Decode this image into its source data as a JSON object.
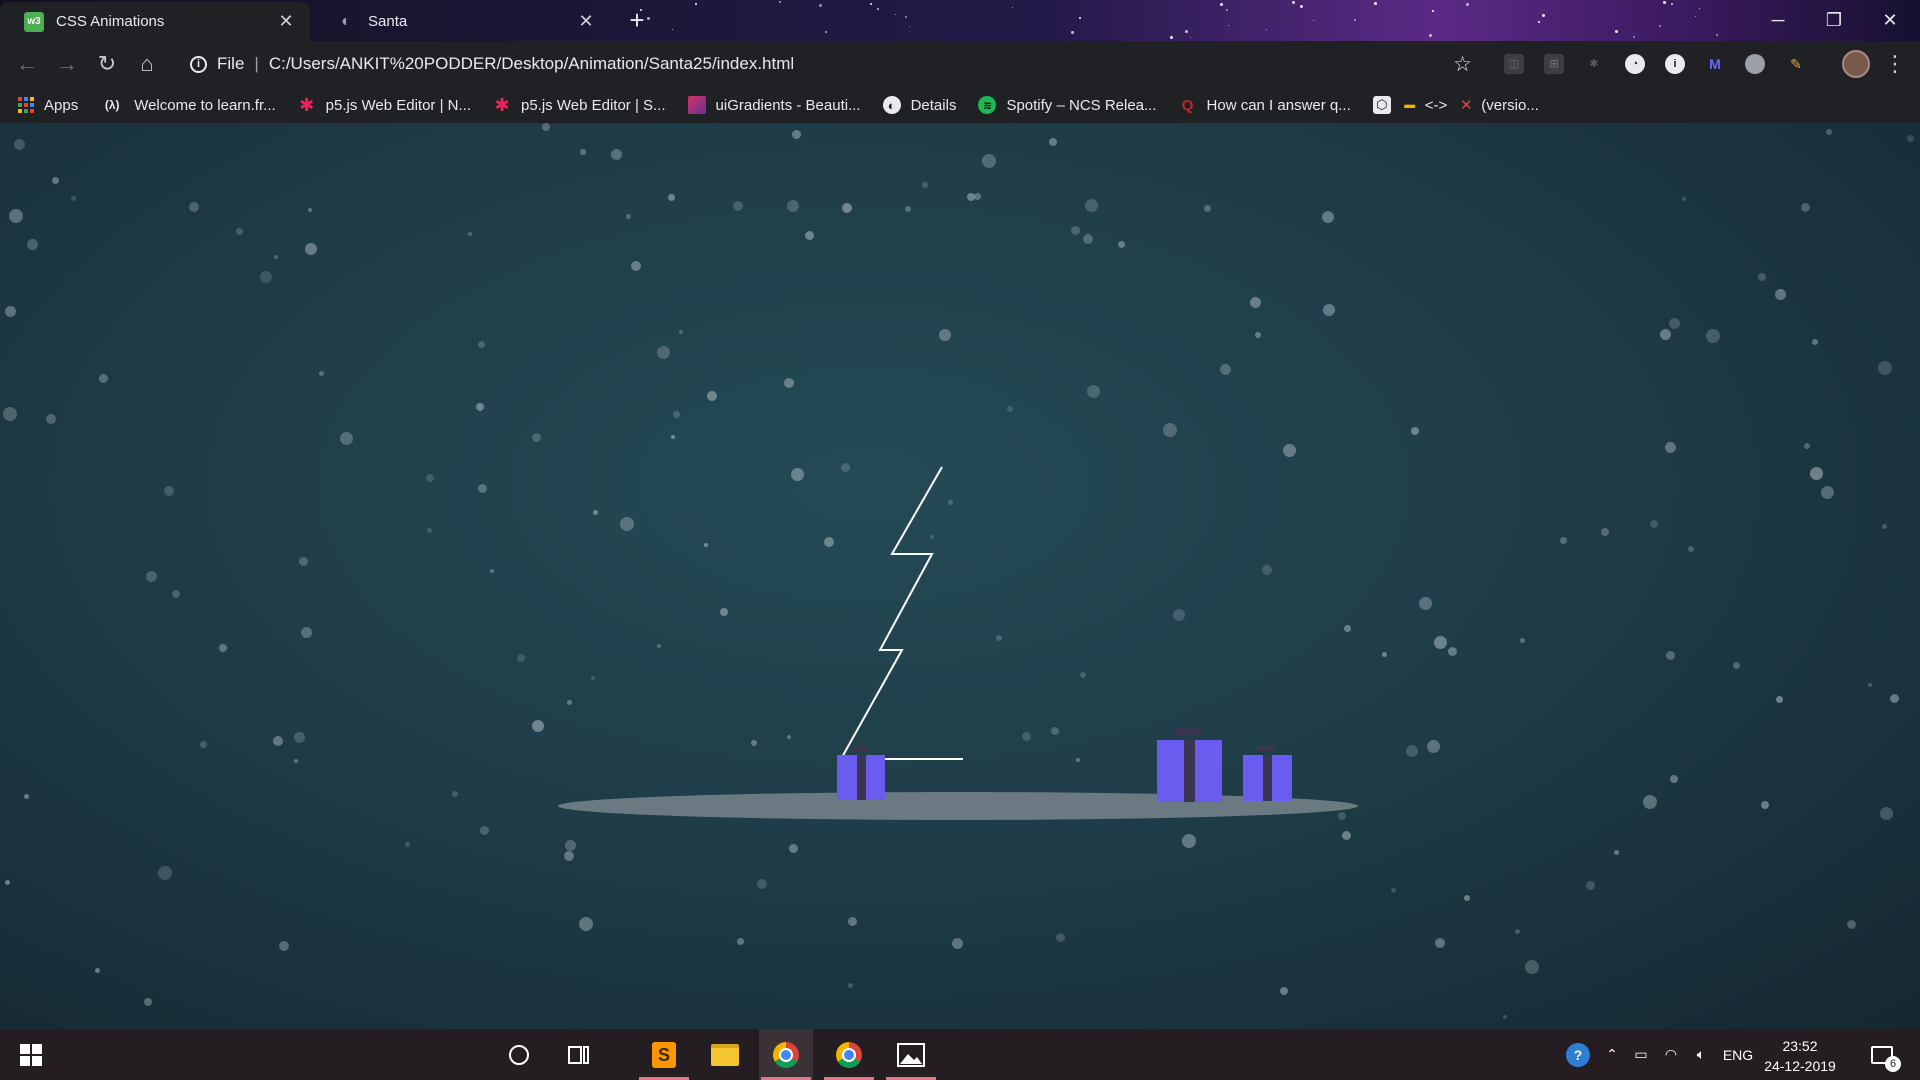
{
  "browser": {
    "tabs": [
      {
        "title": "CSS Animations",
        "favicon": "w3-schools-icon",
        "active": true
      },
      {
        "title": "Santa",
        "favicon": "globe-icon",
        "active": false
      }
    ],
    "new_tab_label": "+",
    "window_controls": {
      "minimize": "─",
      "maximize": "❐",
      "close": "✕"
    },
    "toolbar": {
      "back": "←",
      "forward": "→",
      "reload": "↻",
      "home": "⌂",
      "scheme_label": "File",
      "url": "C:/Users/ANKIT%20PODDER/Desktop/Animation/Santa25/index.html",
      "bookmark_star": "☆",
      "menu": "⋮"
    },
    "bookmarks": [
      {
        "label": "Apps",
        "icon": "apps-grid-icon"
      },
      {
        "label": "Welcome to learn.fr...",
        "icon": "freecodecamp-icon",
        "glyph": "(λ)"
      },
      {
        "label": "p5.js Web Editor | N...",
        "icon": "p5js-asterisk-icon",
        "glyph": "✱"
      },
      {
        "label": "p5.js Web Editor | S...",
        "icon": "p5js-asterisk-icon",
        "glyph": "✱"
      },
      {
        "label": "uiGradients - Beauti...",
        "icon": "uigradients-icon",
        "glyph": ""
      },
      {
        "label": "Details",
        "icon": "globe-icon",
        "glyph": "◐"
      },
      {
        "label": "Spotify – NCS Relea...",
        "icon": "spotify-icon",
        "glyph": "≋"
      },
      {
        "label": "How can I answer q...",
        "icon": "quora-icon",
        "glyph": "Q"
      },
      {
        "label": "",
        "icon": "codepen-icon",
        "glyph": "⬡"
      },
      {
        "label": "<->",
        "icon": "folder-icon",
        "glyph": "▬"
      },
      {
        "label": "(versio...",
        "icon": "x-icon",
        "glyph": "✕"
      }
    ]
  },
  "scene": {
    "bg_color": "#1f3d48",
    "gift_color": "#6b5cf0",
    "ribbon_color": "#3a3550",
    "ground_color": "#6b7a82",
    "tree_stroke": "#ffffff"
  },
  "taskbar": {
    "start_icon": "windows-start-icon",
    "search_icon": "cortana-circle-icon",
    "task_view_icon": "task-view-icon",
    "apps": [
      {
        "name": "sublime-text-icon",
        "running": true,
        "active": false
      },
      {
        "name": "file-explorer-icon",
        "running": false,
        "active": false
      },
      {
        "name": "chrome-icon",
        "running": true,
        "active": true
      },
      {
        "name": "chrome-icon",
        "running": true,
        "active": false
      },
      {
        "name": "photos-icon",
        "running": true,
        "active": false
      }
    ],
    "tray": {
      "language": "ENG",
      "time": "23:52",
      "date": "24-12-2019",
      "notification_count": "6"
    }
  }
}
